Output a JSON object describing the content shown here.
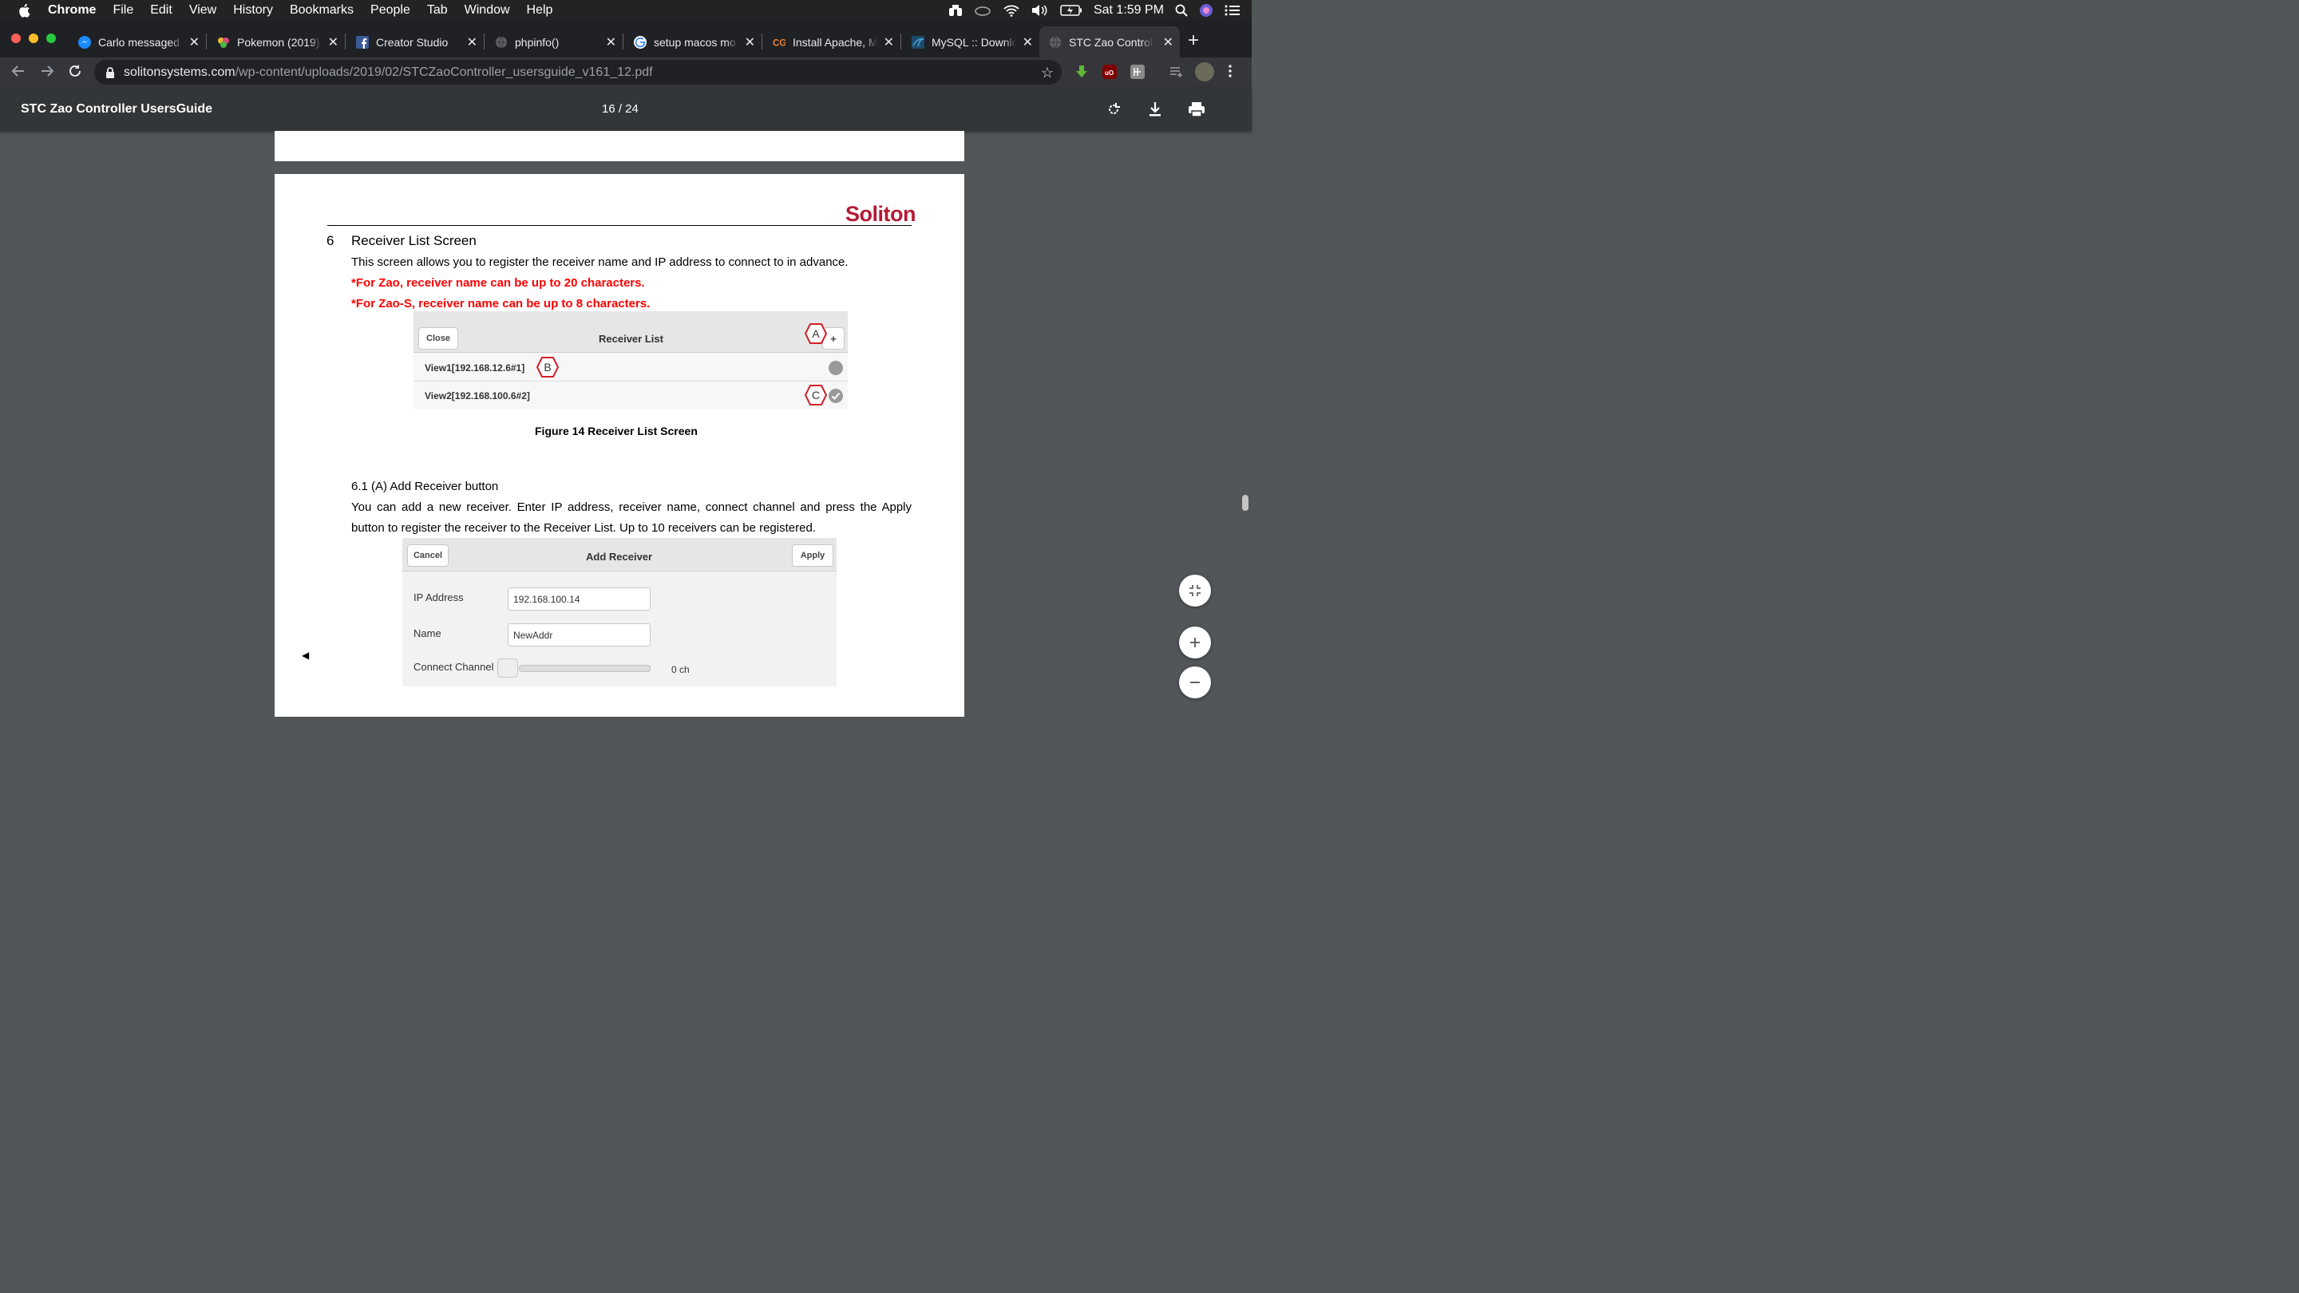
{
  "menubar": {
    "app_name": "Chrome",
    "items": [
      "File",
      "Edit",
      "View",
      "History",
      "Bookmarks",
      "People",
      "Tab",
      "Window",
      "Help"
    ],
    "clock": "Sat 1:59 PM"
  },
  "tabs": [
    {
      "title": "Carlo messaged",
      "icon": "messenger-icon"
    },
    {
      "title": "Pokemon (2019)",
      "icon": "pokemon-icon"
    },
    {
      "title": "Creator Studio",
      "icon": "facebook-icon"
    },
    {
      "title": "phpinfo()",
      "icon": "globe-icon"
    },
    {
      "title": "setup macos mo",
      "icon": "google-icon"
    },
    {
      "title": "Install Apache, M",
      "icon": "cg-icon"
    },
    {
      "title": "MySQL :: Downlo",
      "icon": "mysql-icon"
    },
    {
      "title": "STC Zao Control",
      "icon": "globe-icon",
      "active": true
    }
  ],
  "toolbar": {
    "url_host": "solitonsystems.com",
    "url_path": "/wp-content/uploads/2019/02/STCZaoController_usersguide_v161_12.pdf"
  },
  "pdf": {
    "title": "STC Zao Controller UsersGuide",
    "page_indicator": "16 / 24"
  },
  "document": {
    "logo": "Soliton",
    "section_number": "6",
    "section_title": "Receiver List Screen",
    "intro": "This screen allows you to register the receiver name and IP address to connect to in advance.",
    "note1": "*For Zao, receiver name can be up to 20 characters.",
    "note2": "*For Zao-S, receiver name can be up to 8 characters.",
    "figure14": {
      "close_label": "Close",
      "title": "Receiver List",
      "add_label": "+",
      "rows": [
        "View1[192.168.12.6#1]",
        "View2[192.168.100.6#2]"
      ],
      "callouts": [
        "A",
        "B",
        "C"
      ],
      "caption": "Figure 14 Receiver List Screen"
    },
    "subsection_title": "6.1  (A) Add Receiver button",
    "sub_para_line1": "You can add a new receiver. Enter IP address, receiver name, connect channel and press the Apply",
    "sub_para_line2": "button to register the receiver to the Receiver List. Up to 10 receivers can be registered.",
    "figure15": {
      "cancel_label": "Cancel",
      "title": "Add Receiver",
      "apply_label": "Apply",
      "ip_label": "IP Address",
      "ip_value": "192.168.100.14",
      "name_label": "Name",
      "name_value": "NewAddr",
      "channel_label": "Connect Channel",
      "channel_value": "0 ch"
    }
  }
}
